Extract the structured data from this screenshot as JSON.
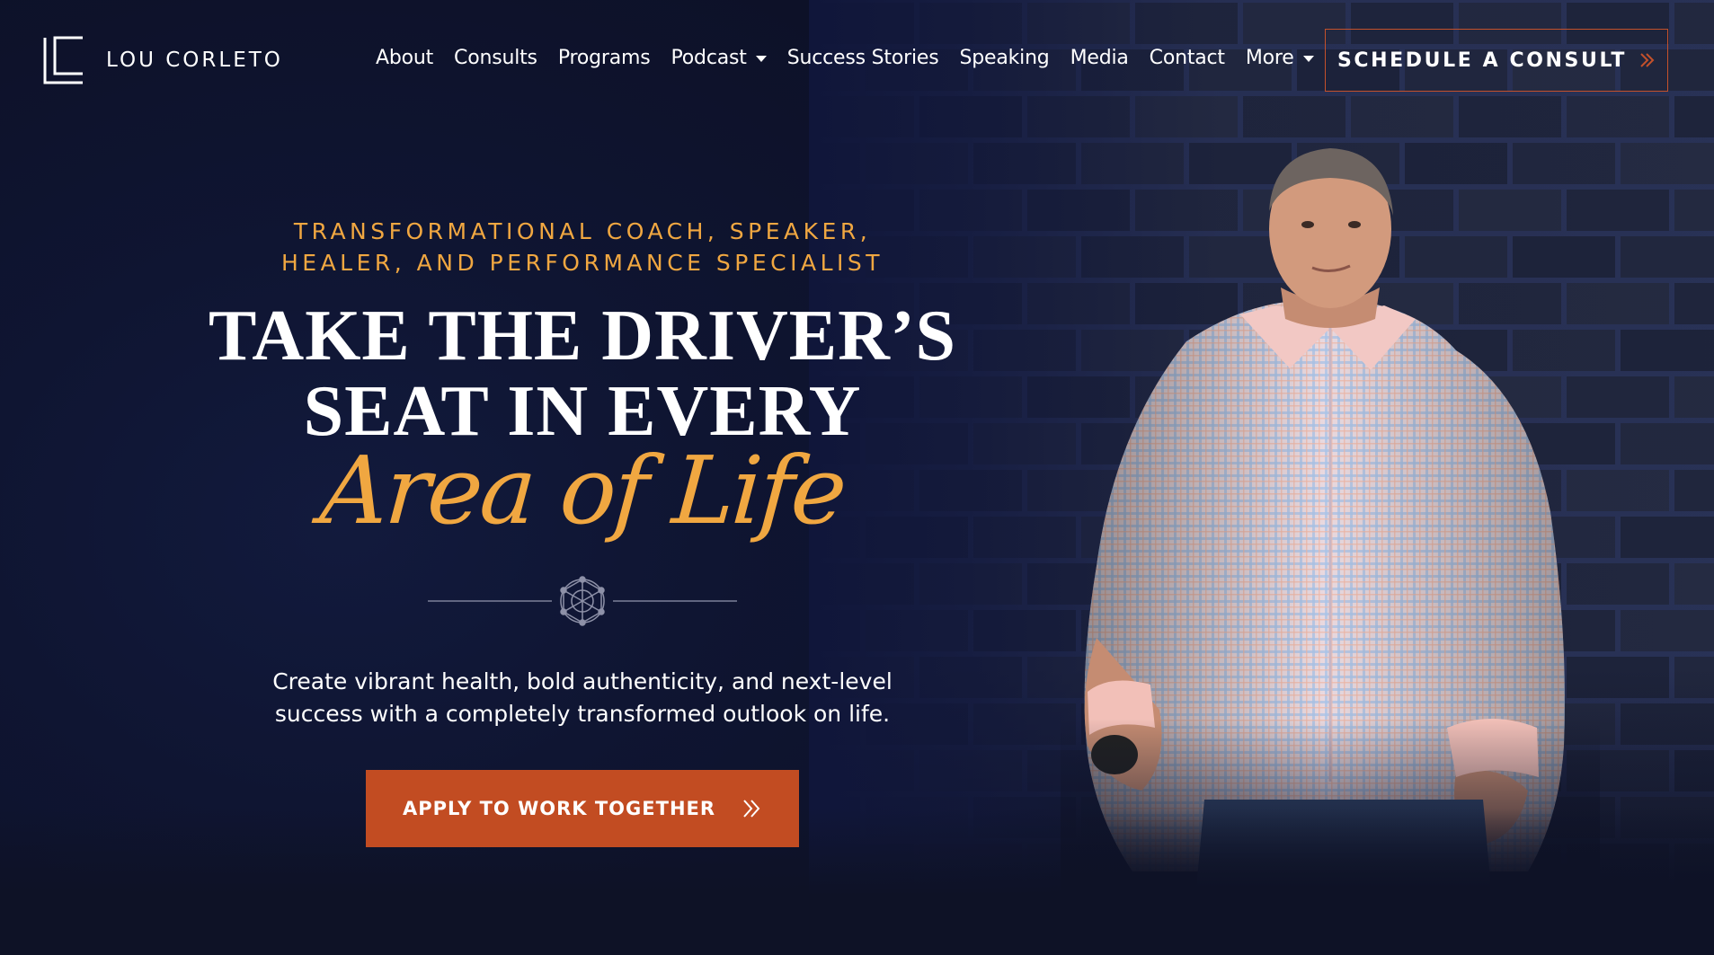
{
  "brand": {
    "name": "LOU CORLETO"
  },
  "nav": {
    "items": [
      {
        "label": "About",
        "has_caret": false
      },
      {
        "label": "Consults",
        "has_caret": false
      },
      {
        "label": "Programs",
        "has_caret": false
      },
      {
        "label": "Podcast",
        "has_caret": true
      },
      {
        "label": "Success Stories",
        "has_caret": false
      },
      {
        "label": "Speaking",
        "has_caret": false
      },
      {
        "label": "Media",
        "has_caret": false
      },
      {
        "label": "Contact",
        "has_caret": false
      },
      {
        "label": "More",
        "has_caret": true
      }
    ],
    "cta_label": "SCHEDULE A CONSULT"
  },
  "hero": {
    "eyebrow": "TRANSFORMATIONAL COACH, SPEAKER, HEALER, AND PERFORMANCE SPECIALIST",
    "headline_line1": "TAKE THE DRIVER’S",
    "headline_line2": "SEAT IN EVERY",
    "script": "Area of Life",
    "subtext": "Create vibrant health, bold authenticity, and next-level success with a completely transformed outlook on life.",
    "cta_label": "APPLY TO WORK TOGETHER"
  },
  "icons": {
    "logo": "lc-monogram-icon",
    "caret": "caret-down-icon",
    "chevron": "double-chevron-right-icon",
    "divider": "sacred-geometry-icon"
  },
  "colors": {
    "background": "#0e1226",
    "accent_gold": "#f0a741",
    "accent_orange": "#c24c22",
    "text": "#ffffff"
  }
}
